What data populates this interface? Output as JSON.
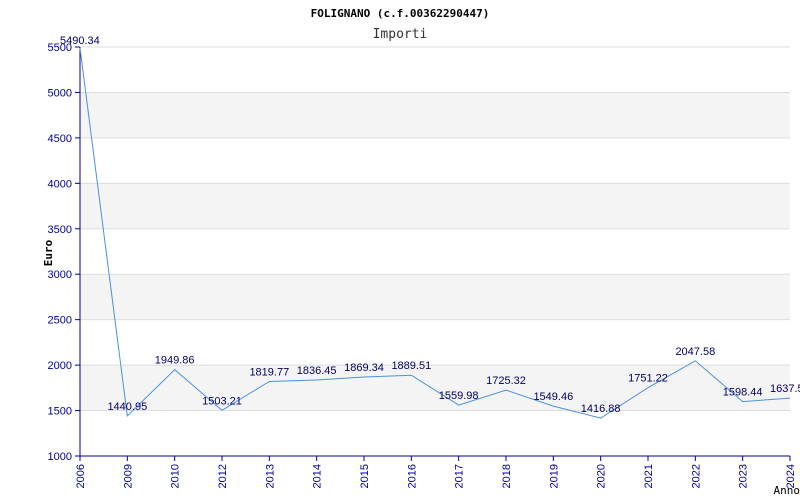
{
  "chart_data": {
    "type": "line",
    "title": "FOLIGNANO (c.f.00362290447)",
    "subtitle": "Importi",
    "xlabel": "Anno",
    "ylabel": "Euro",
    "categories": [
      "2006",
      "2009",
      "2010",
      "2012",
      "2013",
      "2014",
      "2015",
      "2016",
      "2017",
      "2018",
      "2019",
      "2020",
      "2021",
      "2022",
      "2023",
      "2024"
    ],
    "series": [
      {
        "values": [
          5490.34,
          1440.95,
          1949.86,
          1503.21,
          1819.77,
          1836.45,
          1869.34,
          1889.51,
          1559.98,
          1725.32,
          1549.46,
          1416.88,
          1751.22,
          2047.58,
          1598.44,
          1637.5
        ],
        "labels": [
          "5490.34",
          "1440.95",
          "1949.86",
          "1503.21",
          "1819.77",
          "1836.45",
          "1869.34",
          "1889.51",
          "1559.98",
          "1725.32",
          "1549.46",
          "1416.88",
          "1751.22",
          "2047.58",
          "1598.44",
          "1637.5"
        ]
      }
    ],
    "ylim": [
      1000,
      5500
    ],
    "yticks": [
      "1000",
      "1500",
      "2000",
      "2500",
      "3000",
      "3500",
      "4000",
      "4500",
      "5000",
      "5500"
    ],
    "grid": true,
    "band_color": "#f4f4f4",
    "grid_color": "#dddddd",
    "axis_color": "#000099",
    "line_color": "#4a90e2"
  }
}
